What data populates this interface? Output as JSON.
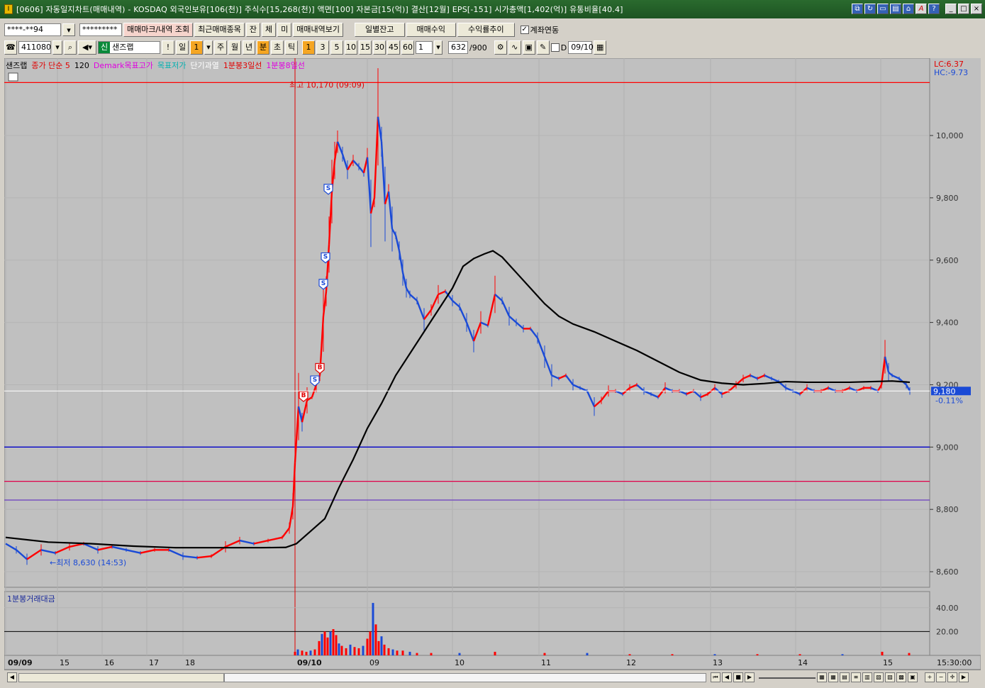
{
  "window": {
    "title": "[0606] 자동일지차트(매매내역) - KOSDAQ 외국인보유[106(천)] 주식수[15,268(천)] 액면[100] 자본금[15(억)] 결산[12월] EPS[-151] 시가총액[1,402(억)] 유통비율[40.4]",
    "app_icon": "I"
  },
  "toolbar1": {
    "account": "****-**94",
    "password": "*********",
    "btn_marks": "매매마크/내역 조회",
    "btn_recent": "최근매매종목",
    "btn_jan": "잔",
    "btn_che": "체",
    "btn_mi": "미",
    "btn_history": "매매내역보기",
    "btn_daily_balance": "일별잔고",
    "btn_profit": "매매수익",
    "btn_return": "수익률추이",
    "account_link_label": "계좌연동",
    "account_link_checked": "✓"
  },
  "toolbar2": {
    "code": "411080",
    "sin": "신",
    "stock_name": "샌즈랩",
    "period_day_label": "일",
    "period_num": "1",
    "periods": [
      "주",
      "월",
      "년",
      "분",
      "초",
      "틱"
    ],
    "minutes": [
      "1",
      "3",
      "5",
      "10",
      "15",
      "30",
      "45",
      "60"
    ],
    "custom_period": "1",
    "count": "632",
    "max_count": "/900",
    "date_checkbox_label": "D",
    "date": "09/10"
  },
  "legend": {
    "stock": "샌즈랩",
    "ma": "종가 단순 5",
    "ma_period": "120",
    "demark_high": "Demark목표고가",
    "demark_low": "목표저가",
    "overheat": "단기과열",
    "line3": "1분봉3일선",
    "line8": "1분봉8일선"
  },
  "colors": {
    "up": "#ff0000",
    "down": "#1a4ad6",
    "ma": "#000000",
    "demark_high": "#ff00ff",
    "demark_low": "#00a0a0",
    "current_price_box": "#1a4ad6"
  },
  "chart_data": {
    "type": "candlestick",
    "lc": "LC:6.37",
    "hc": "HC:-9.73",
    "high_label": "최고 10,170 (09:09)",
    "low_label": "최저 8,630 (14:53)",
    "current_price": "9,180",
    "change_pct": "-0.11%",
    "y_ticks": [
      "10,000",
      "9,800",
      "9,600",
      "9,400",
      "9,200",
      "9,000",
      "8,800",
      "8,600"
    ],
    "ylim": [
      8550,
      10230
    ],
    "high": 10170,
    "low": 8630,
    "hlines": [
      {
        "value": 10170,
        "color": "#ff0000"
      },
      {
        "value": 9000,
        "color": "#0000c8"
      },
      {
        "value": 8890,
        "color": "#e0004a"
      },
      {
        "value": 8830,
        "color": "#6a3cc0"
      }
    ],
    "price_path": [
      [
        0,
        8690
      ],
      [
        15,
        8670
      ],
      [
        30,
        8640
      ],
      [
        50,
        8670
      ],
      [
        70,
        8660
      ],
      [
        90,
        8680
      ],
      [
        110,
        8690
      ],
      [
        130,
        8670
      ],
      [
        150,
        8680
      ],
      [
        170,
        8670
      ],
      [
        190,
        8660
      ],
      [
        210,
        8670
      ],
      [
        230,
        8670
      ],
      [
        250,
        8650
      ],
      [
        270,
        8645
      ],
      [
        290,
        8650
      ],
      [
        310,
        8680
      ],
      [
        330,
        8700
      ],
      [
        350,
        8690
      ],
      [
        370,
        8700
      ],
      [
        390,
        8710
      ],
      [
        400,
        8740
      ],
      [
        405,
        8810
      ],
      [
        408,
        8950
      ],
      [
        413,
        9130
      ],
      [
        418,
        9080
      ],
      [
        425,
        9150
      ],
      [
        432,
        9160
      ],
      [
        438,
        9200
      ],
      [
        443,
        9230
      ],
      [
        448,
        9420
      ],
      [
        452,
        9500
      ],
      [
        456,
        9650
      ],
      [
        460,
        9820
      ],
      [
        464,
        9920
      ],
      [
        468,
        9980
      ],
      [
        475,
        9940
      ],
      [
        482,
        9890
      ],
      [
        490,
        9920
      ],
      [
        498,
        9900
      ],
      [
        505,
        9880
      ],
      [
        510,
        9930
      ],
      [
        515,
        9750
      ],
      [
        520,
        9800
      ],
      [
        525,
        10060
      ],
      [
        530,
        9980
      ],
      [
        535,
        9780
      ],
      [
        540,
        9820
      ],
      [
        545,
        9700
      ],
      [
        550,
        9680
      ],
      [
        555,
        9630
      ],
      [
        560,
        9560
      ],
      [
        565,
        9510
      ],
      [
        570,
        9490
      ],
      [
        580,
        9470
      ],
      [
        590,
        9410
      ],
      [
        600,
        9440
      ],
      [
        610,
        9490
      ],
      [
        620,
        9500
      ],
      [
        630,
        9470
      ],
      [
        640,
        9450
      ],
      [
        650,
        9400
      ],
      [
        660,
        9340
      ],
      [
        670,
        9400
      ],
      [
        680,
        9390
      ],
      [
        690,
        9490
      ],
      [
        700,
        9470
      ],
      [
        710,
        9420
      ],
      [
        720,
        9400
      ],
      [
        730,
        9380
      ],
      [
        740,
        9380
      ],
      [
        750,
        9350
      ],
      [
        760,
        9290
      ],
      [
        770,
        9230
      ],
      [
        780,
        9220
      ],
      [
        790,
        9230
      ],
      [
        800,
        9200
      ],
      [
        810,
        9190
      ],
      [
        820,
        9180
      ],
      [
        830,
        9130
      ],
      [
        840,
        9150
      ],
      [
        850,
        9180
      ],
      [
        860,
        9180
      ],
      [
        870,
        9170
      ],
      [
        880,
        9190
      ],
      [
        890,
        9200
      ],
      [
        900,
        9180
      ],
      [
        910,
        9170
      ],
      [
        920,
        9160
      ],
      [
        930,
        9190
      ],
      [
        940,
        9180
      ],
      [
        950,
        9180
      ],
      [
        960,
        9170
      ],
      [
        970,
        9180
      ],
      [
        980,
        9160
      ],
      [
        990,
        9170
      ],
      [
        1000,
        9190
      ],
      [
        1010,
        9170
      ],
      [
        1020,
        9180
      ],
      [
        1030,
        9200
      ],
      [
        1040,
        9220
      ],
      [
        1050,
        9230
      ],
      [
        1060,
        9220
      ],
      [
        1070,
        9230
      ],
      [
        1080,
        9220
      ],
      [
        1090,
        9210
      ],
      [
        1100,
        9190
      ],
      [
        1110,
        9180
      ],
      [
        1120,
        9170
      ],
      [
        1130,
        9190
      ],
      [
        1140,
        9180
      ],
      [
        1150,
        9180
      ],
      [
        1160,
        9190
      ],
      [
        1170,
        9180
      ],
      [
        1180,
        9180
      ],
      [
        1190,
        9190
      ],
      [
        1200,
        9180
      ],
      [
        1210,
        9190
      ],
      [
        1220,
        9190
      ],
      [
        1230,
        9180
      ],
      [
        1235,
        9200
      ],
      [
        1240,
        9290
      ],
      [
        1245,
        9240
      ],
      [
        1250,
        9230
      ],
      [
        1260,
        9220
      ],
      [
        1270,
        9200
      ],
      [
        1275,
        9180
      ]
    ],
    "ma_path": [
      [
        0,
        8710
      ],
      [
        60,
        8695
      ],
      [
        120,
        8690
      ],
      [
        180,
        8682
      ],
      [
        240,
        8677
      ],
      [
        300,
        8677
      ],
      [
        360,
        8677
      ],
      [
        395,
        8678
      ],
      [
        410,
        8690
      ],
      [
        430,
        8730
      ],
      [
        450,
        8770
      ],
      [
        470,
        8870
      ],
      [
        490,
        8960
      ],
      [
        510,
        9060
      ],
      [
        530,
        9140
      ],
      [
        550,
        9230
      ],
      [
        570,
        9300
      ],
      [
        590,
        9370
      ],
      [
        610,
        9440
      ],
      [
        630,
        9510
      ],
      [
        645,
        9580
      ],
      [
        660,
        9605
      ],
      [
        675,
        9620
      ],
      [
        687,
        9630
      ],
      [
        700,
        9610
      ],
      [
        720,
        9560
      ],
      [
        740,
        9510
      ],
      [
        760,
        9460
      ],
      [
        780,
        9420
      ],
      [
        800,
        9395
      ],
      [
        830,
        9370
      ],
      [
        860,
        9340
      ],
      [
        890,
        9310
      ],
      [
        920,
        9275
      ],
      [
        950,
        9240
      ],
      [
        980,
        9215
      ],
      [
        1010,
        9205
      ],
      [
        1040,
        9200
      ],
      [
        1070,
        9204
      ],
      [
        1100,
        9210
      ],
      [
        1130,
        9208
      ],
      [
        1160,
        9208
      ],
      [
        1190,
        9208
      ],
      [
        1220,
        9210
      ],
      [
        1250,
        9212
      ],
      [
        1275,
        9208
      ]
    ],
    "markers": [
      {
        "label": "S",
        "x": 455,
        "value": 9825,
        "color": "#1a4ad6"
      },
      {
        "label": "S",
        "x": 451,
        "value": 9605,
        "color": "#1a4ad6"
      },
      {
        "label": "S",
        "x": 448,
        "value": 9520,
        "color": "#1a4ad6"
      },
      {
        "label": "B",
        "x": 443,
        "value": 9250,
        "color": "#e00000"
      },
      {
        "label": "S",
        "x": 436,
        "value": 9210,
        "color": "#1a4ad6"
      },
      {
        "label": "B",
        "x": 420,
        "value": 9160,
        "color": "#e00000"
      }
    ],
    "x_ticks": [
      {
        "label": "09/09",
        "x": 0,
        "bold": true
      },
      {
        "label": "15",
        "x": 73
      },
      {
        "label": "16",
        "x": 136
      },
      {
        "label": "17",
        "x": 199
      },
      {
        "label": "18",
        "x": 250
      },
      {
        "label": "09/10",
        "x": 408,
        "bold": true
      },
      {
        "label": "09",
        "x": 510
      },
      {
        "label": "10",
        "x": 630
      },
      {
        "label": "11",
        "x": 752
      },
      {
        "label": "12",
        "x": 872
      },
      {
        "label": "13",
        "x": 994
      },
      {
        "label": "14",
        "x": 1114
      },
      {
        "label": "15",
        "x": 1234
      }
    ],
    "end_time": "15:30:00",
    "volume": {
      "title": "1분봉거래대금",
      "y_ticks": [
        "40.00",
        "20.00"
      ],
      "ylim": [
        0,
        50
      ],
      "spikes": [
        [
          408,
          3
        ],
        [
          412,
          5
        ],
        [
          418,
          4
        ],
        [
          424,
          3
        ],
        [
          430,
          4
        ],
        [
          436,
          5
        ],
        [
          442,
          12
        ],
        [
          446,
          18
        ],
        [
          450,
          20
        ],
        [
          454,
          15
        ],
        [
          458,
          20
        ],
        [
          462,
          22
        ],
        [
          466,
          17
        ],
        [
          470,
          10
        ],
        [
          474,
          8
        ],
        [
          480,
          6
        ],
        [
          486,
          9
        ],
        [
          492,
          7
        ],
        [
          498,
          6
        ],
        [
          504,
          8
        ],
        [
          510,
          14
        ],
        [
          514,
          20
        ],
        [
          518,
          44
        ],
        [
          522,
          26
        ],
        [
          526,
          12
        ],
        [
          530,
          16
        ],
        [
          534,
          9
        ],
        [
          540,
          6
        ],
        [
          546,
          5
        ],
        [
          552,
          4
        ],
        [
          560,
          4
        ],
        [
          570,
          3
        ],
        [
          580,
          2
        ],
        [
          600,
          2
        ],
        [
          640,
          2
        ],
        [
          690,
          3
        ],
        [
          760,
          2
        ],
        [
          820,
          2
        ],
        [
          880,
          1
        ],
        [
          940,
          1
        ],
        [
          1000,
          1
        ],
        [
          1060,
          1
        ],
        [
          1120,
          1
        ],
        [
          1180,
          1
        ],
        [
          1236,
          3
        ],
        [
          1274,
          2
        ]
      ]
    }
  }
}
